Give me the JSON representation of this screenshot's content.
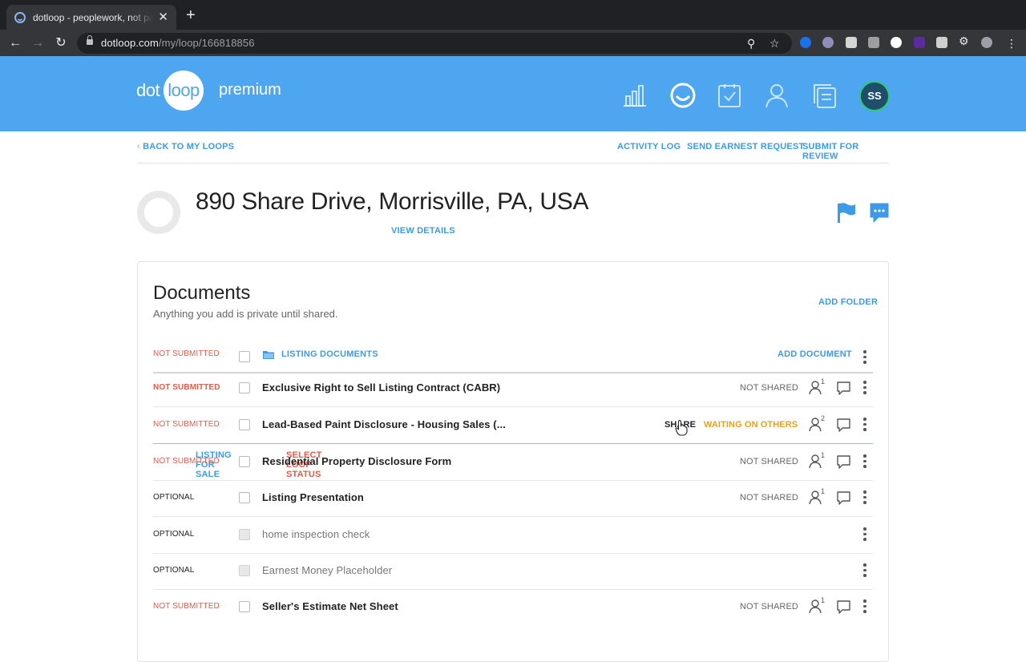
{
  "browser": {
    "tab_title": "dotloop - peoplework, not paperwork",
    "tab_close": "✕",
    "new_tab": "+",
    "url_host": "dotloop.com",
    "url_path": "/my/loop/166818856"
  },
  "header": {
    "logo_dot": "dot",
    "logo_loop": "loop",
    "logo_premium": "premium",
    "avatar_initials": "SS"
  },
  "subnav": {
    "back": "BACK TO MY LOOPS",
    "activity_log": "ACTIVITY LOG",
    "send_earnest": "SEND EARNEST REQUEST",
    "submit_review": "SUBMIT FOR REVIEW"
  },
  "loop": {
    "title": "890 Share Drive, Morrisville, PA, USA",
    "type": "LISTING FOR SALE",
    "status": "SELECT LOOP STATUS",
    "details": "VIEW DETAILS"
  },
  "documents": {
    "title": "Documents",
    "subtitle": "Anything you add is private until shared.",
    "add_folder": "ADD FOLDER",
    "folder": {
      "status": "NOT SUBMITTED",
      "name": "LISTING DOCUMENTS",
      "add_document": "ADD DOCUMENT"
    },
    "rows": [
      {
        "status": "NOT SUBMITTED",
        "name": "Exclusive Right to Sell Listing Contract (CABR)",
        "share_state": "NOT SHARED",
        "people": "1"
      },
      {
        "status": "NOT SUBMITTED",
        "name": "Lead-Based Paint Disclosure - Housing Sales (...",
        "share_button": "SHARE",
        "share_state": "WAITING ON OTHERS",
        "people": "2"
      },
      {
        "status": "NOT SUBMITTED",
        "name": "Residential Property Disclosure Form",
        "share_state": "NOT SHARED",
        "people": "1"
      },
      {
        "status": "OPTIONAL",
        "name": "Listing Presentation",
        "share_state": "NOT SHARED",
        "people": "1"
      },
      {
        "status": "OPTIONAL",
        "name": "home inspection check"
      },
      {
        "status": "OPTIONAL",
        "name": "Earnest Money Placeholder"
      },
      {
        "status": "NOT SUBMITTED",
        "name": "Seller's Estimate Net Sheet",
        "share_state": "NOT SHARED",
        "people": "1"
      }
    ]
  },
  "colors": {
    "brand_blue": "#4ea6f0",
    "link_blue": "#3d9ae8",
    "status_red": "#e05a47",
    "waiting_orange": "#e6a11d"
  }
}
